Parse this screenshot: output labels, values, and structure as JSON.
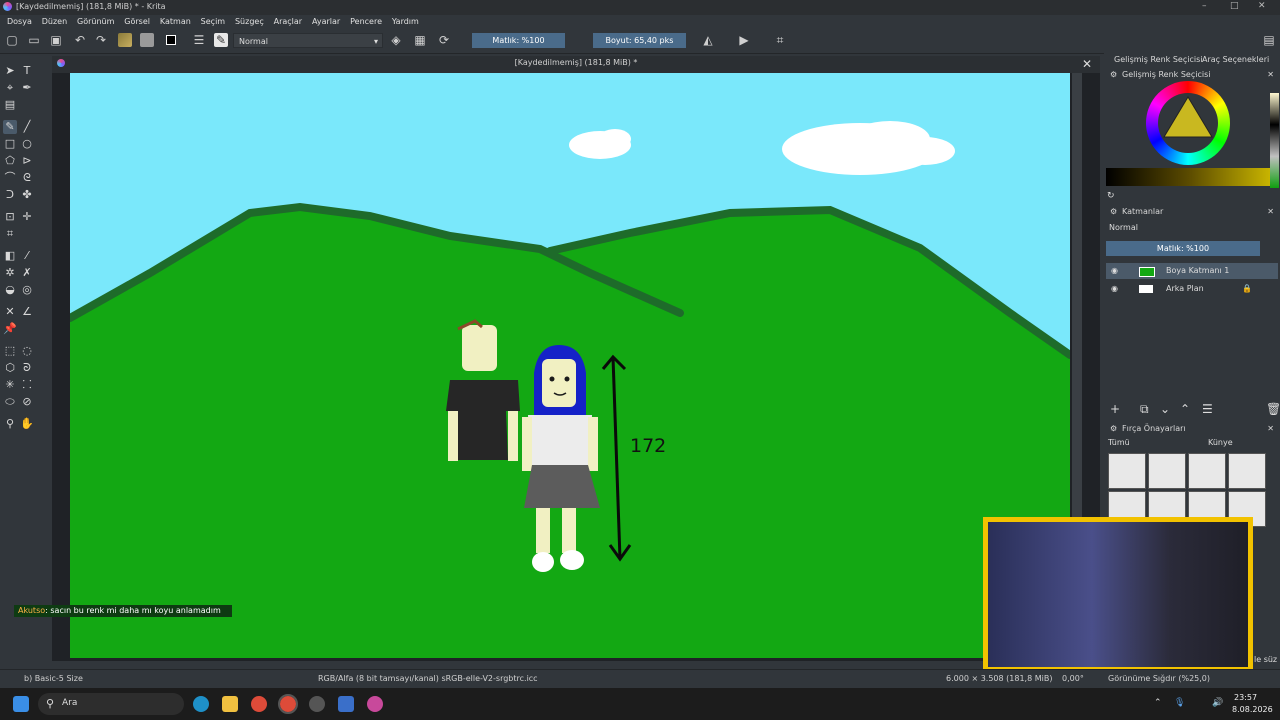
{
  "window": {
    "title": "[Kaydedilmemiş] (181,8 MiB) * - Krita",
    "controls": [
      "–",
      "□",
      "✕"
    ]
  },
  "menu": [
    "Dosya",
    "Düzen",
    "Görünüm",
    "Görsel",
    "Katman",
    "Seçim",
    "Süzgeç",
    "Araçlar",
    "Ayarlar",
    "Pencere",
    "Yardım"
  ],
  "toolbar": {
    "blend_mode": "Normal",
    "opacity": "Matlık: %100",
    "size": "Boyut: 65,40 pks"
  },
  "document": {
    "tab_title": "[Kaydedilmemiş] (181,8 MiB) *",
    "drawing_label": "172",
    "colors": {
      "sky": "#7ae8fb",
      "grass": "#13a813",
      "hill_edge": "#1e6b2a"
    }
  },
  "chat": {
    "user": "Akutso",
    "message": ": sacın bu renk mi daha mı koyu anlamadım"
  },
  "status": {
    "brush": "b) Basic-5 Size",
    "color_info": "RGB/Alfa (8 bit tamsayı/kanal) sRGB-elle-V2-srgbtrc.icc",
    "dimensions": "6.000 × 3.508 (181,8 MiB)",
    "rotation": "0,00°",
    "zoom": "Görünüme Sığdır (%25,0)"
  },
  "dockers": {
    "tabs": [
      "Gelişmiş Renk Seçicisi",
      "Araç Seçenekleri"
    ],
    "color_selector_title": "Gelişmiş Renk Seçicisi",
    "layers_title": "Katmanlar",
    "layers_blend": "Normal",
    "layers_opacity": "Matlık: %100",
    "layers": [
      {
        "name": "Boya Katmanı 1",
        "selected": true
      },
      {
        "name": "Arka Plan",
        "selected": false
      }
    ],
    "brush_presets_title": "Fırça Önayarları",
    "brush_filter": "Tümü",
    "brush_tag": "Künye",
    "brush_search_hint": "le süz"
  },
  "taskbar": {
    "search": "Ara",
    "time": "23:57",
    "date": "8.08.2026"
  }
}
